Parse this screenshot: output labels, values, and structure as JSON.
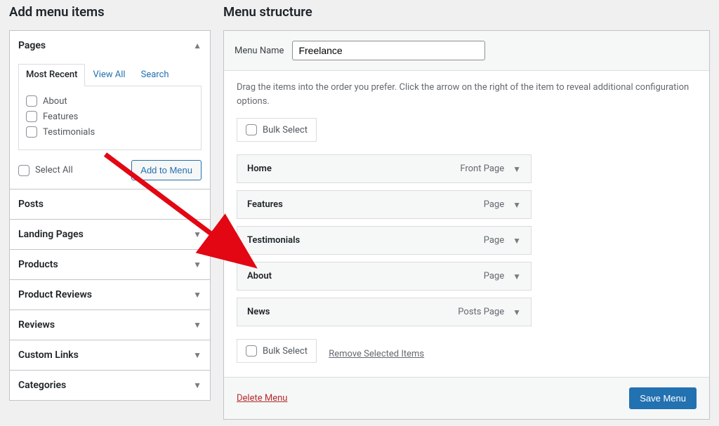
{
  "left": {
    "title": "Add menu items",
    "accordion": [
      {
        "label": "Pages",
        "open": true,
        "tabs": [
          "Most Recent",
          "View All",
          "Search"
        ],
        "active_tab_index": 0,
        "items": [
          "About",
          "Features",
          "Testimonials"
        ],
        "select_all_label": "Select All",
        "add_button_label": "Add to Menu"
      },
      {
        "label": "Posts",
        "open": false
      },
      {
        "label": "Landing Pages",
        "open": false
      },
      {
        "label": "Products",
        "open": false
      },
      {
        "label": "Product Reviews",
        "open": false
      },
      {
        "label": "Reviews",
        "open": false
      },
      {
        "label": "Custom Links",
        "open": false
      },
      {
        "label": "Categories",
        "open": false
      }
    ]
  },
  "right": {
    "title": "Menu structure",
    "menu_name_label": "Menu Name",
    "menu_name_value": "Freelance",
    "instructions": "Drag the items into the order you prefer. Click the arrow on the right of the item to reveal additional configuration options.",
    "bulk_select_label": "Bulk Select",
    "remove_selected_label": "Remove Selected Items",
    "menu_items": [
      {
        "title": "Home",
        "type": "Front Page"
      },
      {
        "title": "Features",
        "type": "Page"
      },
      {
        "title": "Testimonials",
        "type": "Page"
      },
      {
        "title": "About",
        "type": "Page"
      },
      {
        "title": "News",
        "type": "Posts Page"
      }
    ],
    "delete_label": "Delete Menu",
    "save_label": "Save Menu"
  }
}
